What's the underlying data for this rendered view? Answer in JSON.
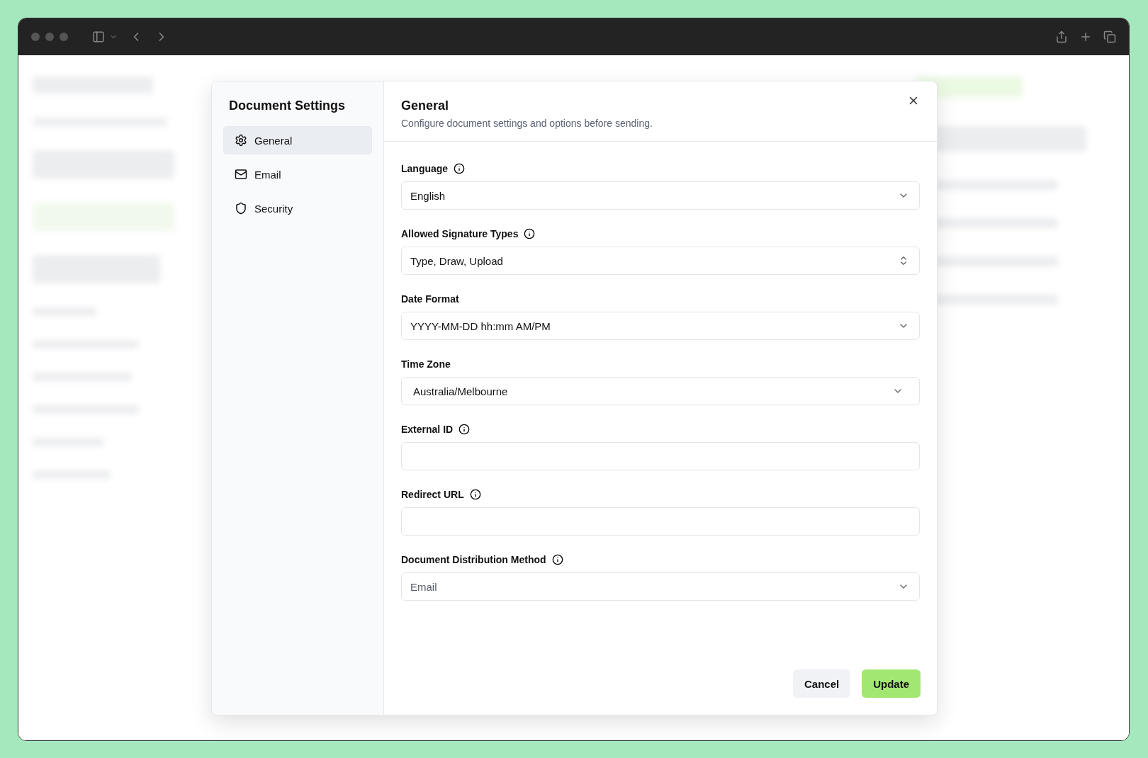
{
  "dialog": {
    "title": "Document Settings",
    "nav": [
      {
        "label": "General",
        "selected": true
      },
      {
        "label": "Email",
        "selected": false
      },
      {
        "label": "Security",
        "selected": false
      }
    ],
    "section": {
      "title": "General",
      "subtitle": "Configure document settings and options before sending."
    },
    "fields": [
      {
        "label": "Language",
        "info": true,
        "kind": "select",
        "value": "English",
        "muted": false
      },
      {
        "label": "Allowed Signature Types",
        "info": true,
        "kind": "multiselect",
        "value": "Type, Draw, Upload",
        "muted": false
      },
      {
        "label": "Date Format",
        "info": false,
        "kind": "select",
        "value": "YYYY-MM-DD hh:mm AM/PM",
        "muted": false
      },
      {
        "label": "Time Zone",
        "info": false,
        "kind": "combobox",
        "value": "Australia/Melbourne",
        "muted": false
      },
      {
        "label": "External ID",
        "info": true,
        "kind": "input"
      },
      {
        "label": "Redirect URL",
        "info": true,
        "kind": "input"
      },
      {
        "label": "Document Distribution Method",
        "info": true,
        "kind": "select",
        "value": "Email",
        "muted": true
      }
    ],
    "buttons": [
      {
        "label": "Cancel",
        "kind": "secondary"
      },
      {
        "label": "Update",
        "kind": "primary"
      }
    ]
  }
}
